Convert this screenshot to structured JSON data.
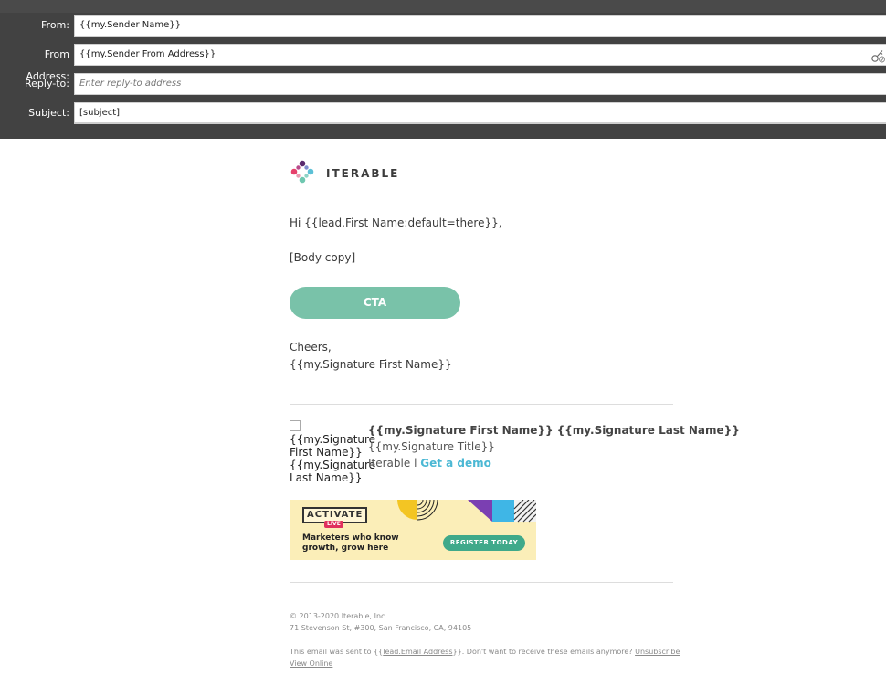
{
  "header": {
    "fields": [
      {
        "label": "From:",
        "value": "{{my.Sender Name}}"
      },
      {
        "label": "From Address:",
        "value": "{{my.Sender From Address}}"
      },
      {
        "label": "Reply-to:",
        "placeholder": "Enter reply-to address"
      },
      {
        "label": "Subject:",
        "value": "[subject]"
      }
    ]
  },
  "email": {
    "logo_text": "ITERABLE",
    "greeting": "Hi {{lead.First Name:default=there}},",
    "body": "[Body copy]",
    "cta_label": "CTA",
    "closing": "Cheers,",
    "closing_name": "{{my.Signature First Name}}",
    "signature": {
      "image_alt": [
        "{{my.Signature",
        "First Name}}",
        "{{my.Signature",
        "Last Name}}"
      ],
      "name": "{{my.Signature First Name}} {{my.Signature Last Name}}",
      "title": "{{my.Signature Title}}",
      "company": "Iterable l ",
      "link": "Get a demo"
    },
    "banner": {
      "title": "ACTIVATE",
      "badge": "LIVE",
      "tagline_1": "Marketers who know",
      "tagline_2": "growth, grow here",
      "button": "REGISTER TODAY"
    },
    "footer": {
      "copyright": "© 2013-2020 Iterable, Inc.",
      "address": "71 Stevenson St, #300, San Francisco, CA, 94105",
      "sent_prefix": "This email was sent to {{",
      "sent_token": "lead.Email Address",
      "sent_suffix": "}}. Don't want to receive these emails anymore? ",
      "unsubscribe": "Unsubscribe",
      "view_online": "View Online"
    }
  },
  "colors": {
    "header_bg": "#424242",
    "cta": "#79c2a9",
    "link": "#4bb8d4",
    "banner_bg": "#fbeeb8",
    "banner_button": "#3fa98a"
  }
}
